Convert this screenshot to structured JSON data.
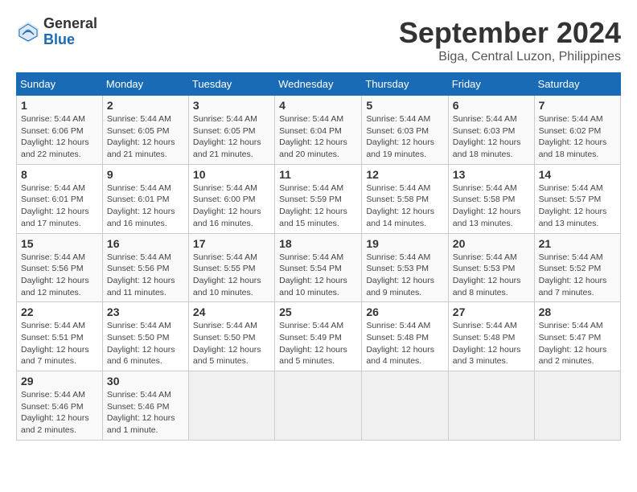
{
  "logo": {
    "general": "General",
    "blue": "Blue"
  },
  "title": "September 2024",
  "subtitle": "Biga, Central Luzon, Philippines",
  "headers": [
    "Sunday",
    "Monday",
    "Tuesday",
    "Wednesday",
    "Thursday",
    "Friday",
    "Saturday"
  ],
  "weeks": [
    [
      {
        "day": "1",
        "info": "Sunrise: 5:44 AM\nSunset: 6:06 PM\nDaylight: 12 hours\nand 22 minutes."
      },
      {
        "day": "2",
        "info": "Sunrise: 5:44 AM\nSunset: 6:05 PM\nDaylight: 12 hours\nand 21 minutes."
      },
      {
        "day": "3",
        "info": "Sunrise: 5:44 AM\nSunset: 6:05 PM\nDaylight: 12 hours\nand 21 minutes."
      },
      {
        "day": "4",
        "info": "Sunrise: 5:44 AM\nSunset: 6:04 PM\nDaylight: 12 hours\nand 20 minutes."
      },
      {
        "day": "5",
        "info": "Sunrise: 5:44 AM\nSunset: 6:03 PM\nDaylight: 12 hours\nand 19 minutes."
      },
      {
        "day": "6",
        "info": "Sunrise: 5:44 AM\nSunset: 6:03 PM\nDaylight: 12 hours\nand 18 minutes."
      },
      {
        "day": "7",
        "info": "Sunrise: 5:44 AM\nSunset: 6:02 PM\nDaylight: 12 hours\nand 18 minutes."
      }
    ],
    [
      {
        "day": "8",
        "info": "Sunrise: 5:44 AM\nSunset: 6:01 PM\nDaylight: 12 hours\nand 17 minutes."
      },
      {
        "day": "9",
        "info": "Sunrise: 5:44 AM\nSunset: 6:01 PM\nDaylight: 12 hours\nand 16 minutes."
      },
      {
        "day": "10",
        "info": "Sunrise: 5:44 AM\nSunset: 6:00 PM\nDaylight: 12 hours\nand 16 minutes."
      },
      {
        "day": "11",
        "info": "Sunrise: 5:44 AM\nSunset: 5:59 PM\nDaylight: 12 hours\nand 15 minutes."
      },
      {
        "day": "12",
        "info": "Sunrise: 5:44 AM\nSunset: 5:58 PM\nDaylight: 12 hours\nand 14 minutes."
      },
      {
        "day": "13",
        "info": "Sunrise: 5:44 AM\nSunset: 5:58 PM\nDaylight: 12 hours\nand 13 minutes."
      },
      {
        "day": "14",
        "info": "Sunrise: 5:44 AM\nSunset: 5:57 PM\nDaylight: 12 hours\nand 13 minutes."
      }
    ],
    [
      {
        "day": "15",
        "info": "Sunrise: 5:44 AM\nSunset: 5:56 PM\nDaylight: 12 hours\nand 12 minutes."
      },
      {
        "day": "16",
        "info": "Sunrise: 5:44 AM\nSunset: 5:56 PM\nDaylight: 12 hours\nand 11 minutes."
      },
      {
        "day": "17",
        "info": "Sunrise: 5:44 AM\nSunset: 5:55 PM\nDaylight: 12 hours\nand 10 minutes."
      },
      {
        "day": "18",
        "info": "Sunrise: 5:44 AM\nSunset: 5:54 PM\nDaylight: 12 hours\nand 10 minutes."
      },
      {
        "day": "19",
        "info": "Sunrise: 5:44 AM\nSunset: 5:53 PM\nDaylight: 12 hours\nand 9 minutes."
      },
      {
        "day": "20",
        "info": "Sunrise: 5:44 AM\nSunset: 5:53 PM\nDaylight: 12 hours\nand 8 minutes."
      },
      {
        "day": "21",
        "info": "Sunrise: 5:44 AM\nSunset: 5:52 PM\nDaylight: 12 hours\nand 7 minutes."
      }
    ],
    [
      {
        "day": "22",
        "info": "Sunrise: 5:44 AM\nSunset: 5:51 PM\nDaylight: 12 hours\nand 7 minutes."
      },
      {
        "day": "23",
        "info": "Sunrise: 5:44 AM\nSunset: 5:50 PM\nDaylight: 12 hours\nand 6 minutes."
      },
      {
        "day": "24",
        "info": "Sunrise: 5:44 AM\nSunset: 5:50 PM\nDaylight: 12 hours\nand 5 minutes."
      },
      {
        "day": "25",
        "info": "Sunrise: 5:44 AM\nSunset: 5:49 PM\nDaylight: 12 hours\nand 5 minutes."
      },
      {
        "day": "26",
        "info": "Sunrise: 5:44 AM\nSunset: 5:48 PM\nDaylight: 12 hours\nand 4 minutes."
      },
      {
        "day": "27",
        "info": "Sunrise: 5:44 AM\nSunset: 5:48 PM\nDaylight: 12 hours\nand 3 minutes."
      },
      {
        "day": "28",
        "info": "Sunrise: 5:44 AM\nSunset: 5:47 PM\nDaylight: 12 hours\nand 2 minutes."
      }
    ],
    [
      {
        "day": "29",
        "info": "Sunrise: 5:44 AM\nSunset: 5:46 PM\nDaylight: 12 hours\nand 2 minutes."
      },
      {
        "day": "30",
        "info": "Sunrise: 5:44 AM\nSunset: 5:46 PM\nDaylight: 12 hours\nand 1 minute."
      },
      {
        "day": "",
        "info": ""
      },
      {
        "day": "",
        "info": ""
      },
      {
        "day": "",
        "info": ""
      },
      {
        "day": "",
        "info": ""
      },
      {
        "day": "",
        "info": ""
      }
    ]
  ]
}
